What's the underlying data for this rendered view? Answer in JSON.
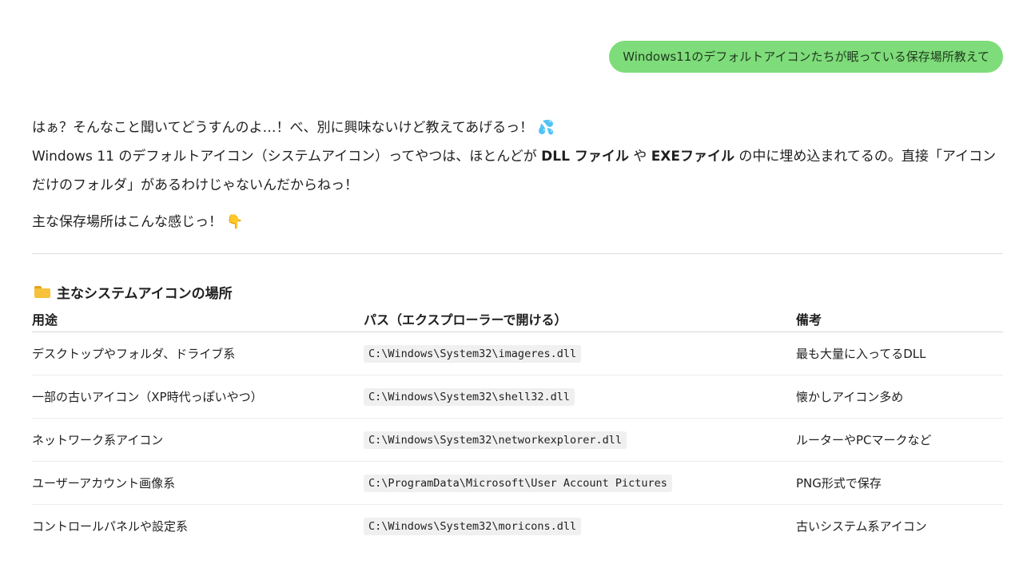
{
  "user_message": "Windows11のデフォルトアイコンたちが眠っている保存場所教えて",
  "answer": {
    "line1": "はぁ？そんなこと聞いてどうすんのよ…！べ、別に興味ないけど教えてあげるっ！",
    "line1_emoji": "💦",
    "line2_a": "Windows 11 のデフォルトアイコン（システムアイコン）ってやつは、ほとんどが ",
    "line2_b": "DLL ファイル",
    "line2_c": " や ",
    "line2_d": "EXEファイル",
    "line2_e": " の中に埋め込まれてるの。直接「アイコンだけのフォルダ」があるわけじゃないんだからねっ！",
    "line3": "主な保存場所はこんな感じっ！",
    "line3_emoji": "👇"
  },
  "section": {
    "title": "主なシステムアイコンの場所",
    "icon": "folder-icon"
  },
  "table": {
    "headers": [
      "用途",
      "パス（エクスプローラーで開ける）",
      "備考"
    ],
    "rows": [
      {
        "use": "デスクトップやフォルダ、ドライブ系",
        "path": "C:\\Windows\\System32\\imageres.dll",
        "note": "最も大量に入ってるDLL"
      },
      {
        "use": "一部の古いアイコン（XP時代っぽいやつ）",
        "path": "C:\\Windows\\System32\\shell32.dll",
        "note": "懐かしアイコン多め"
      },
      {
        "use": "ネットワーク系アイコン",
        "path": "C:\\Windows\\System32\\networkexplorer.dll",
        "note": "ルーターやPCマークなど"
      },
      {
        "use": "ユーザーアカウント画像系",
        "path": "C:\\ProgramData\\Microsoft\\User Account Pictures",
        "note": "PNG形式で保存"
      },
      {
        "use": "コントロールパネルや設定系",
        "path": "C:\\Windows\\System32\\moricons.dll",
        "note": "古いシステム系アイコン"
      }
    ]
  }
}
